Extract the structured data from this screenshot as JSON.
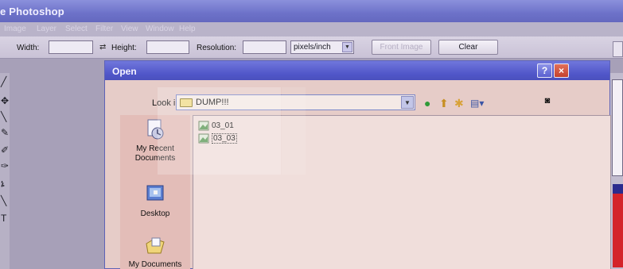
{
  "app": {
    "title": "e Photoshop",
    "menu": [
      "Image",
      "Layer",
      "Select",
      "Filter",
      "View",
      "Window",
      "Help"
    ]
  },
  "options_bar": {
    "width_label": "Width:",
    "width_value": "",
    "height_label": "Height:",
    "height_value": "",
    "resolution_label": "Resolution:",
    "resolution_value": "",
    "units": "pixels/inch",
    "front_image_label": "Front Image",
    "clear_label": "Clear"
  },
  "dialog": {
    "title": "Open",
    "help": "?",
    "close": "×",
    "look_in_label": "Look in:",
    "look_in_value": "DUMP!!!",
    "places": [
      {
        "label": "My Recent Documents",
        "icon": "recent-documents-icon"
      },
      {
        "label": "Desktop",
        "icon": "desktop-icon"
      },
      {
        "label": "My Documents",
        "icon": "my-documents-icon"
      }
    ],
    "files": [
      {
        "name": "03_01",
        "icon": "image-file-icon"
      },
      {
        "name": "03_03",
        "icon": "image-file-icon",
        "focused": true
      }
    ]
  },
  "colors": {
    "titlebar": "#6d72c9",
    "dialog_bg": "#e6ccc8",
    "file_list_bg": "#f0dedb",
    "close_red": "#c3402d"
  }
}
